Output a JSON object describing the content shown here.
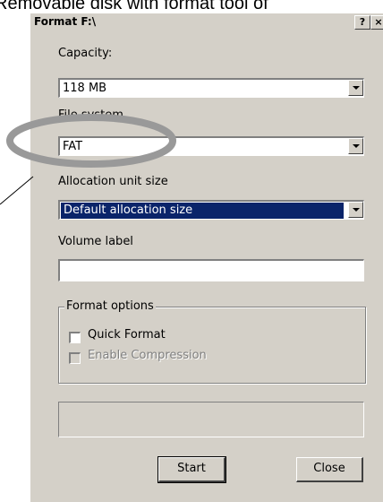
{
  "caption": "Removable disk with format tool of",
  "dialog": {
    "title": "Format F:\\",
    "help_label": "?",
    "close_label": "×"
  },
  "capacity": {
    "label": "Capacity:",
    "value": "118 MB"
  },
  "file_system": {
    "label": "File system",
    "value": "FAT"
  },
  "allocation": {
    "label": "Allocation unit size",
    "value": "Default allocation size"
  },
  "volume": {
    "label": "Volume label",
    "value": ""
  },
  "format_options": {
    "label": "Format options",
    "quick_format": {
      "label": "Quick Format",
      "checked": false
    },
    "enable_compression": {
      "label": "Enable Compression",
      "checked": false,
      "disabled": true
    }
  },
  "buttons": {
    "start": "Start",
    "close": "Close"
  },
  "colors": {
    "dialog_bg": "#d4d0c8",
    "selection": "#0a246a",
    "highlight_ellipse": "#999999"
  }
}
